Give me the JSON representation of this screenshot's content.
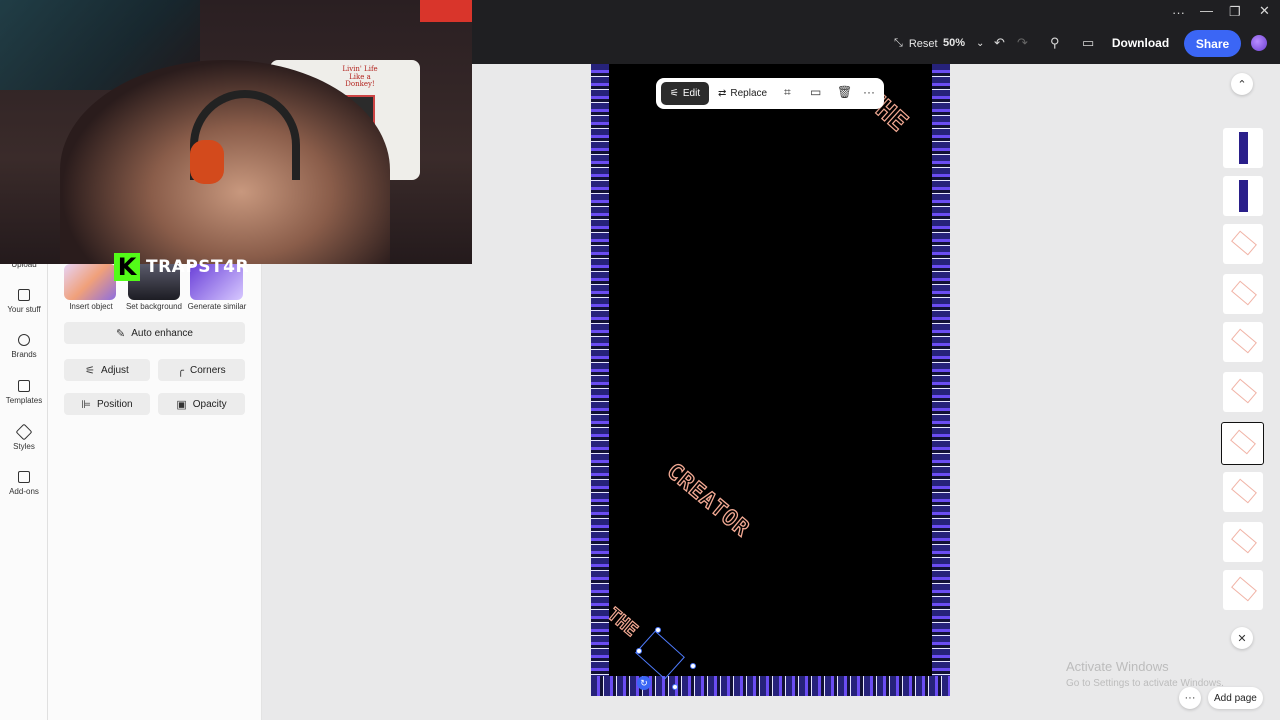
{
  "topbar": {
    "reset_label": "Reset",
    "zoom": "50%",
    "download_label": "Download",
    "share_label": "Share"
  },
  "rail": {
    "items": [
      {
        "label": "Upload",
        "icon": "upload-icon"
      },
      {
        "label": "Your stuff",
        "icon": "folder-icon"
      },
      {
        "label": "Brands",
        "icon": "brand-icon"
      },
      {
        "label": "Templates",
        "icon": "templates-icon"
      },
      {
        "label": "Styles",
        "icon": "styles-icon"
      },
      {
        "label": "Add-ons",
        "icon": "addons-icon"
      }
    ]
  },
  "panel": {
    "quick_actions": [
      {
        "label": "Insert object"
      },
      {
        "label": "Set background"
      },
      {
        "label": "Generate similar"
      }
    ],
    "auto_enhance": "Auto enhance",
    "adjust": "Adjust",
    "corners": "Corners",
    "position": "Position",
    "opacity": "Opacity"
  },
  "overlay": {
    "streamer_name": "TRAPST4R",
    "logo_letter": "K",
    "shirt_text": "Livin' Life Like a Donkey!"
  },
  "canvas": {
    "main_text": "CREATOR",
    "corner_text": "THE"
  },
  "floating_toolbar": {
    "edit_label": "Edit",
    "replace_label": "Replace"
  },
  "pages": {
    "count": 11,
    "selected_index": 6,
    "add_page_label": "Add page"
  },
  "watermark": {
    "title": "Activate Windows",
    "subtitle": "Go to Settings to activate Windows."
  },
  "colors": {
    "accent": "#3b66f5",
    "topbar_bg": "#1f1f22",
    "kick_green": "#53fc18",
    "frame_purple": "#6a4cf2",
    "text_outline": "#f2a993"
  }
}
